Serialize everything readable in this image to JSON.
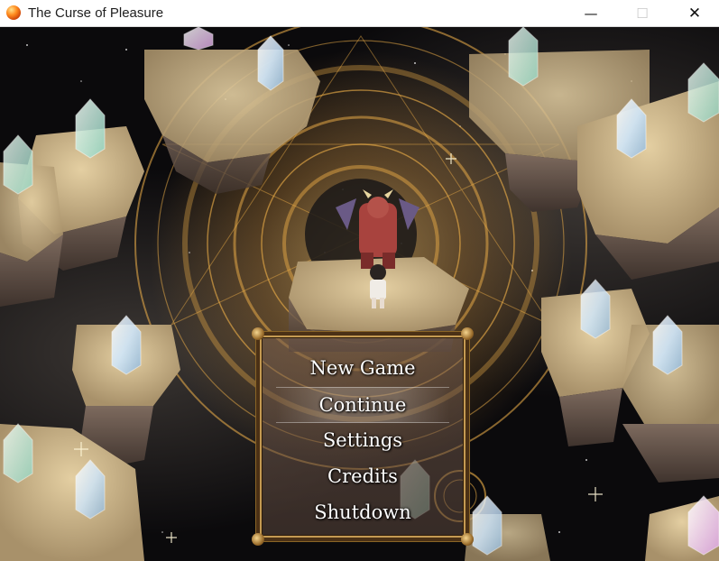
{
  "window": {
    "title": "The Curse of Pleasure",
    "minimize_glyph": "—",
    "maximize_glyph": "☐",
    "close_glyph": "✕"
  },
  "icons": {
    "app_icon": "orange-orb-icon",
    "minimize": "minimize-icon",
    "maximize": "maximize-icon",
    "close": "close-icon"
  },
  "title_menu": {
    "selected_index": 1,
    "items": [
      {
        "label": "New Game"
      },
      {
        "label": "Continue"
      },
      {
        "label": "Settings"
      },
      {
        "label": "Credits"
      },
      {
        "label": "Shutdown"
      }
    ]
  },
  "colors": {
    "menu_text": "#ffffff",
    "frame_gold": "#c49a52",
    "magic_circle": "#f2b24a",
    "background": "#0b0a0c"
  }
}
